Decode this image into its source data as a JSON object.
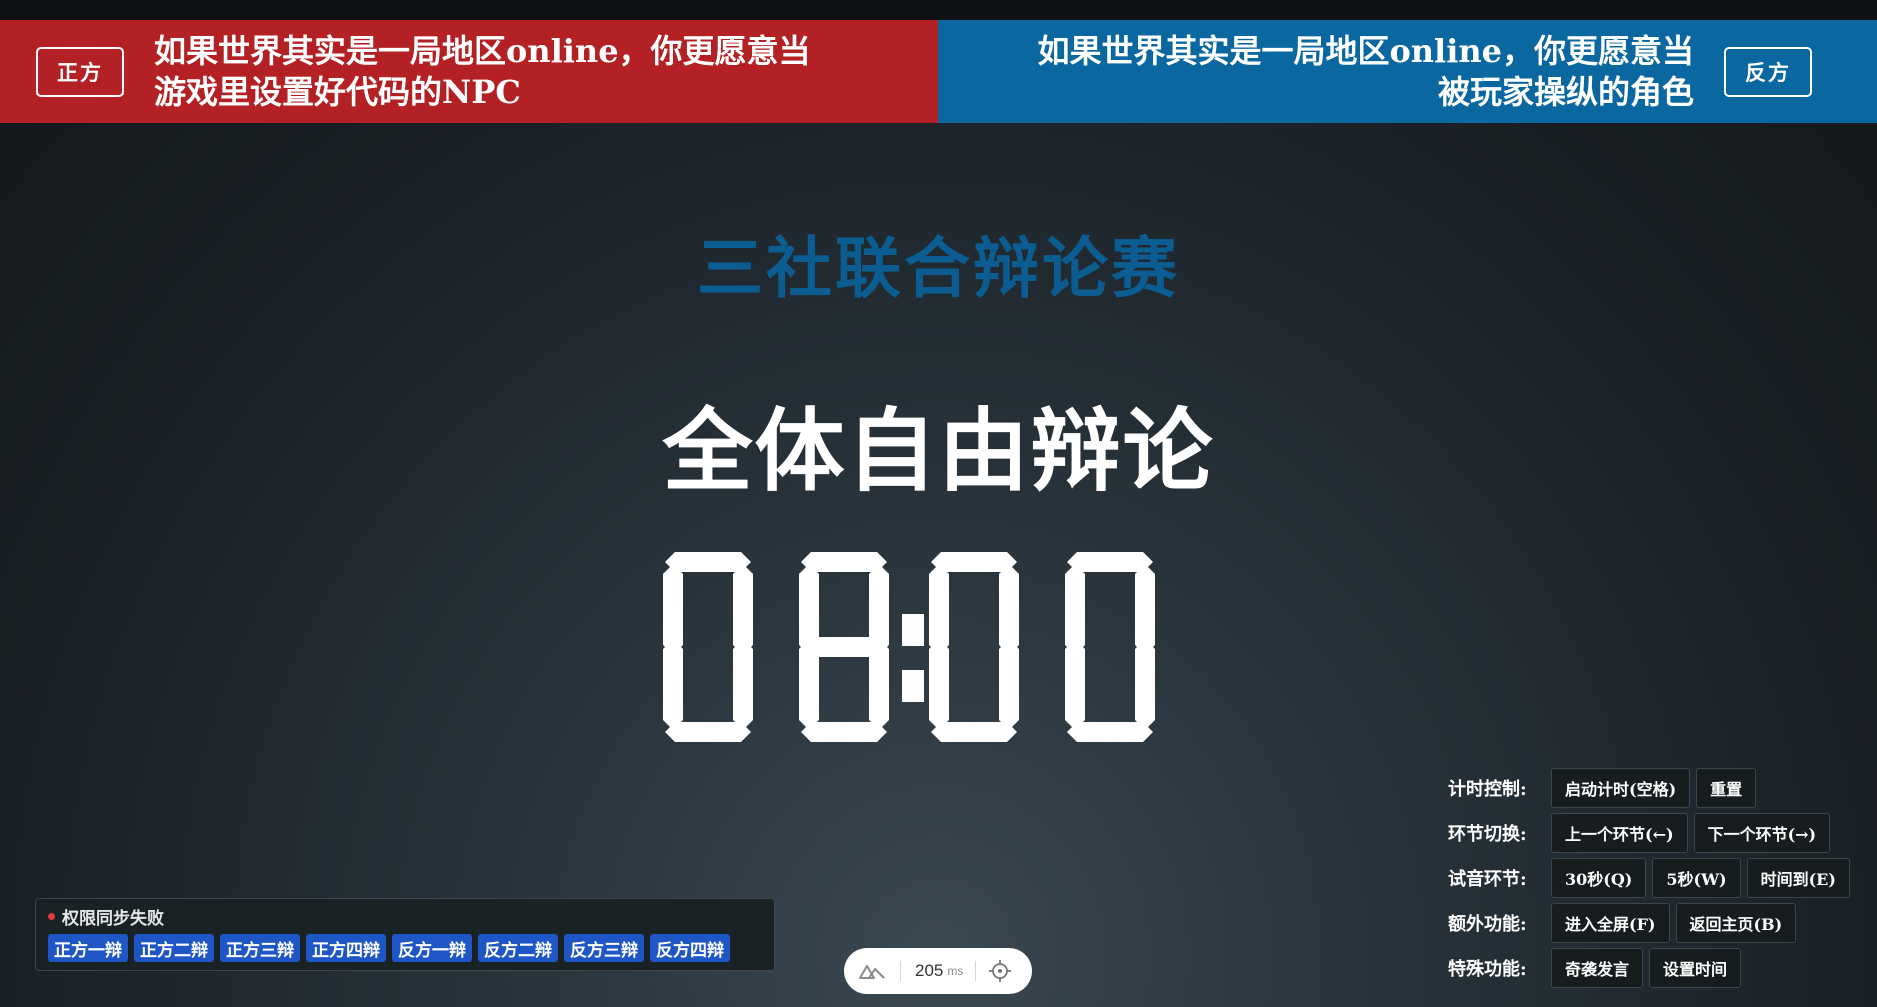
{
  "affirmative": {
    "tag": "正方",
    "motion_line1": "如果世界其实是一局地区online，你更愿意当",
    "motion_line2": "游戏里设置好代码的NPC",
    "color": "#b32124"
  },
  "negative": {
    "tag": "反方",
    "motion_line1": "如果世界其实是一局地区online，你更愿意当",
    "motion_line2": "被玩家操纵的角色",
    "color": "#0a67a0"
  },
  "event_title": "三社联合辩论赛",
  "stage_title": "全体自由辩论",
  "timer": {
    "display": "08:00",
    "digits": [
      "0",
      "8",
      "0",
      "0"
    ]
  },
  "controls": {
    "timing": {
      "label": "计时控制:",
      "start": "启动计时(空格)",
      "reset": "重置"
    },
    "stage_switch": {
      "label": "环节切换:",
      "prev": "上一个环节(←)",
      "next": "下一个环节(→)"
    },
    "sound_test": {
      "label": "试音环节:",
      "s30": "30秒(Q)",
      "s5": "5秒(W)",
      "timeup": "时间到(E)"
    },
    "extra": {
      "label": "额外功能:",
      "fullscreen": "进入全屏(F)",
      "home": "返回主页(B)"
    },
    "special": {
      "label": "特殊功能:",
      "surprise": "奇袭发言",
      "set_time": "设置时间"
    }
  },
  "permissions": {
    "status": "权限同步失败",
    "status_color": "#e33b3b",
    "speakers": [
      "正方一辩",
      "正方二辩",
      "正方三辩",
      "正方四辩",
      "反方一辩",
      "反方二辩",
      "反方三辩",
      "反方四辩"
    ]
  },
  "latency": {
    "value": "205",
    "unit": "ms",
    "logo_icon": "nuxt-logo-icon",
    "target_icon": "crosshair-icon"
  }
}
